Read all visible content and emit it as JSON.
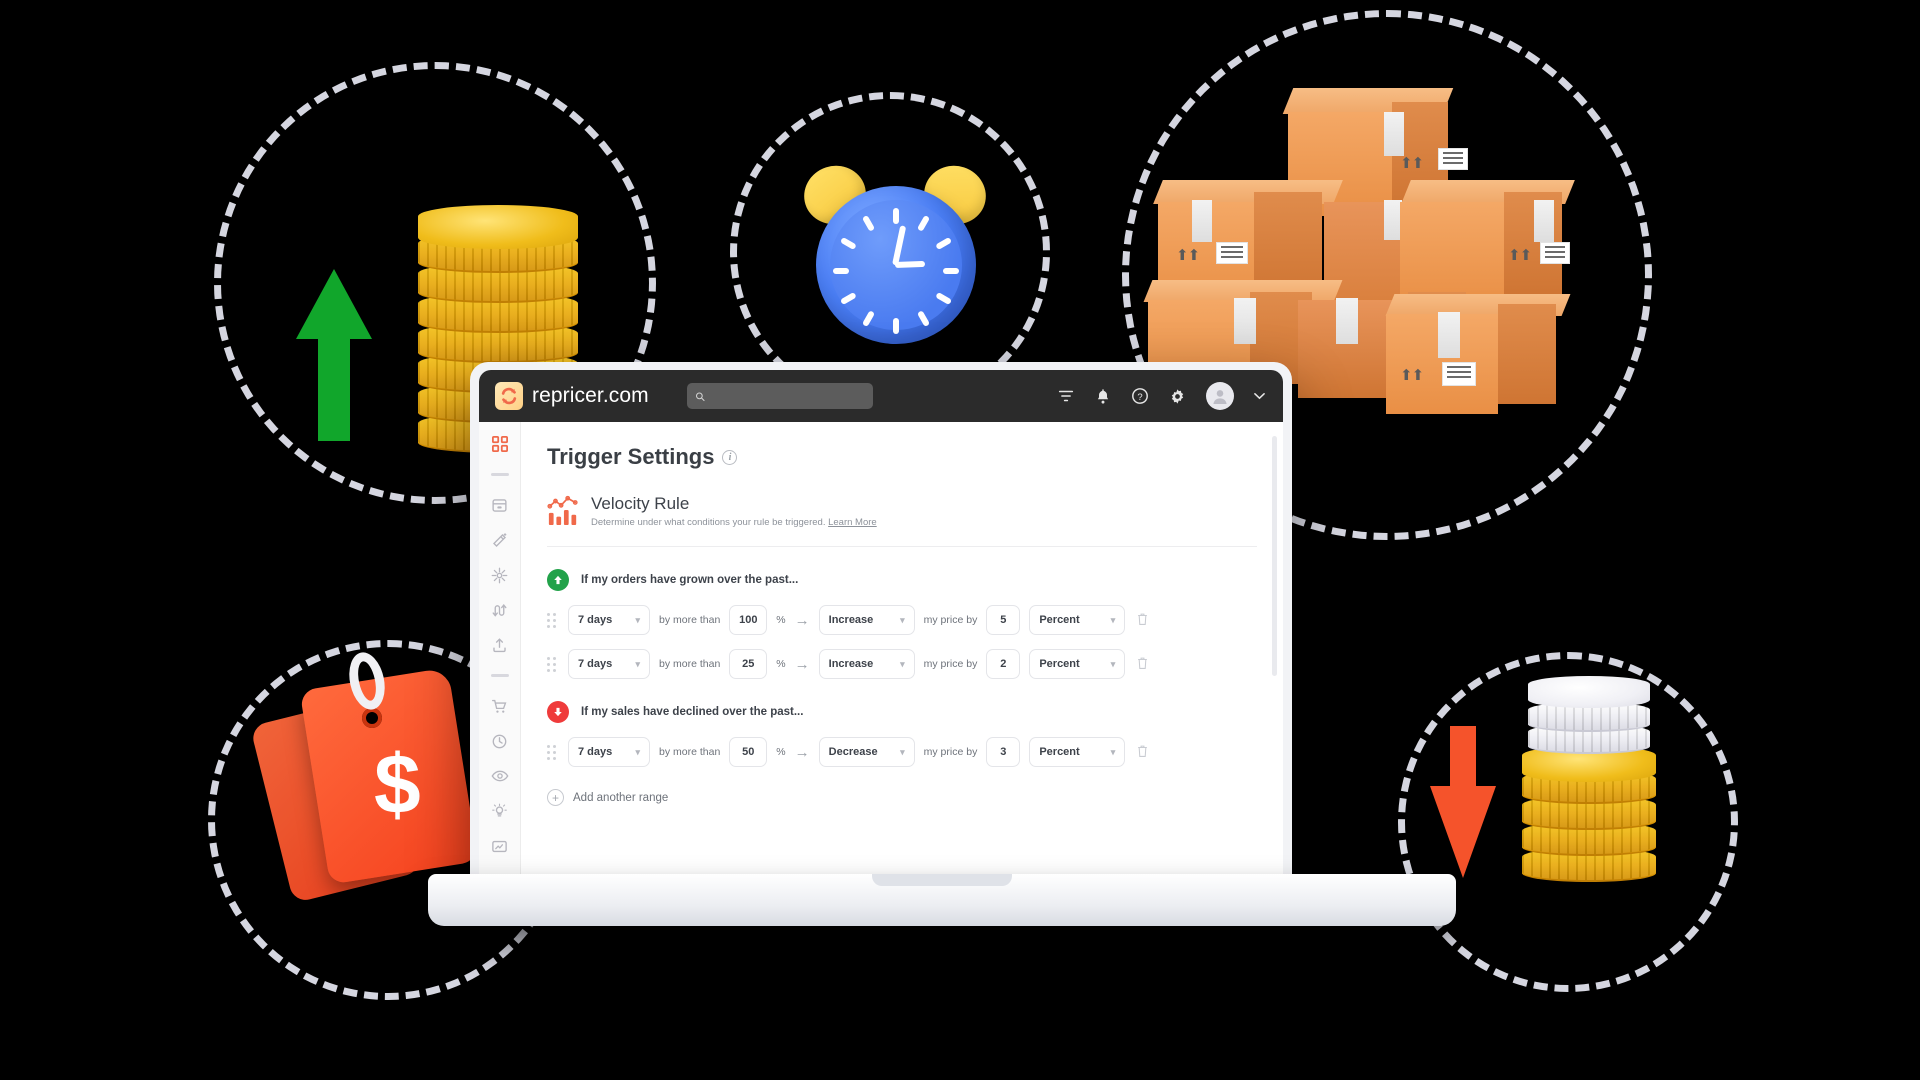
{
  "brand": {
    "name": "repricer.com",
    "logo_icon": "repricer-arrows-logo",
    "accent": "#f0694a"
  },
  "topbar": {
    "search": {
      "placeholder": "",
      "value": "",
      "icon": "search-icon"
    },
    "icons": [
      {
        "name": "filter-icon",
        "label": "Filter"
      },
      {
        "name": "bell-icon",
        "label": "Notifications"
      },
      {
        "name": "help-icon",
        "label": "Help"
      },
      {
        "name": "gear-icon",
        "label": "Settings"
      },
      {
        "name": "avatar",
        "label": "Account"
      },
      {
        "name": "chevron-down-icon",
        "label": "Account menu"
      }
    ]
  },
  "sidebar": {
    "items": [
      {
        "name": "dashboard-icon",
        "label": "Dashboard",
        "active": true
      },
      {
        "name": "inbox-icon",
        "label": "Inbox"
      },
      {
        "name": "magic-wand-icon",
        "label": "Smart rules"
      },
      {
        "name": "network-icon",
        "label": "Network"
      },
      {
        "name": "repricer-icon",
        "label": "Repricer"
      },
      {
        "name": "upload-icon",
        "label": "Upload"
      },
      {
        "name": "cart-icon",
        "label": "Orders"
      },
      {
        "name": "history-icon",
        "label": "History"
      },
      {
        "name": "eye-icon",
        "label": "Monitor"
      },
      {
        "name": "bulb-icon",
        "label": "Insights"
      },
      {
        "name": "report-icon",
        "label": "Reports"
      }
    ]
  },
  "page": {
    "title": "Trigger Settings",
    "title_info_icon": "info-icon"
  },
  "rule": {
    "icon": "velocity-chart-icon",
    "title": "Velocity Rule",
    "description": "Determine under what conditions your rule be triggered.",
    "learn_more": "Learn More"
  },
  "conditions": [
    {
      "badge": "arrow-up-icon",
      "badge_color": "#22a24a",
      "heading": "If my orders have grown over the past...",
      "rows": [
        {
          "period": "7 days",
          "comparator_label": "by more than",
          "threshold": "100",
          "threshold_unit": "%",
          "action": "Increase",
          "action_label": "my price by",
          "amount": "5",
          "amount_unit": "Percent"
        },
        {
          "period": "7 days",
          "comparator_label": "by more than",
          "threshold": "25",
          "threshold_unit": "%",
          "action": "Increase",
          "action_label": "my price by",
          "amount": "2",
          "amount_unit": "Percent"
        }
      ]
    },
    {
      "badge": "arrow-down-icon",
      "badge_color": "#ef3b3b",
      "heading": "If my sales have declined over the past...",
      "rows": [
        {
          "period": "7 days",
          "comparator_label": "by more than",
          "threshold": "50",
          "threshold_unit": "%",
          "action": "Decrease",
          "action_label": "my price by",
          "amount": "3",
          "amount_unit": "Percent"
        }
      ]
    }
  ],
  "add_range": {
    "label": "Add another range",
    "icon": "plus-circle-icon"
  },
  "decor": {
    "bubbles": [
      {
        "name": "coins-up-bubble"
      },
      {
        "name": "clock-bubble"
      },
      {
        "name": "boxes-bubble"
      },
      {
        "name": "price-tags-bubble"
      },
      {
        "name": "coins-down-bubble"
      }
    ],
    "illustrations": [
      {
        "name": "green-up-arrow-illustration",
        "color": "#11a62b"
      },
      {
        "name": "gold-coin-stack-illustration",
        "color": "#e8a90c"
      },
      {
        "name": "blue-alarm-clock-illustration",
        "color": "#4a7ef5"
      },
      {
        "name": "cardboard-boxes-illustration",
        "color": "#e98f45"
      },
      {
        "name": "price-tags-illustration",
        "color": "#f5421e"
      },
      {
        "name": "red-down-arrow-illustration",
        "color": "#f5532b"
      },
      {
        "name": "silver-gold-coin-stack-illustration",
        "color": "#e8a90c"
      }
    ]
  }
}
